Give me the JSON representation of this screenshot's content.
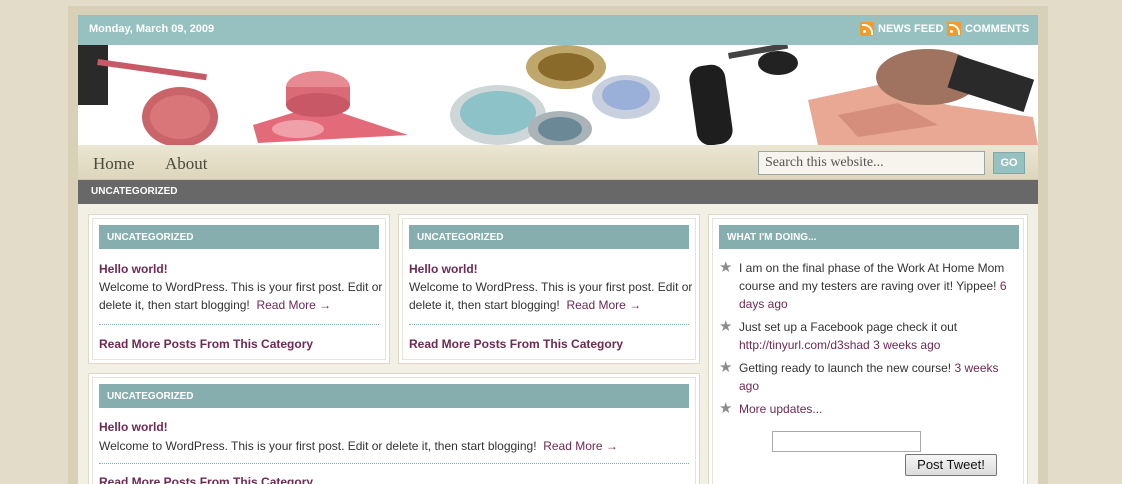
{
  "header": {
    "date": "Monday, March 09, 2009",
    "news_feed": "NEWS FEED",
    "comments": "COMMENTS"
  },
  "nav": {
    "items": [
      "Home",
      "About"
    ],
    "search_placeholder": "Search this website...",
    "go": "GO"
  },
  "category_bar": "UNCATEGORIZED",
  "posts": [
    {
      "category": "UNCATEGORIZED",
      "title": "Hello world!",
      "body": "Welcome to WordPress. This is your first post. Edit or delete it, then start blogging!",
      "read_more": "Read More →",
      "more_link": "Read More Posts From This Category"
    },
    {
      "category": "UNCATEGORIZED",
      "title": "Hello world!",
      "body": "Welcome to WordPress. This is your first post. Edit or delete it, then start blogging!",
      "read_more": "Read More →",
      "more_link": "Read More Posts From This Category"
    },
    {
      "category": "UNCATEGORIZED",
      "title": "Hello world!",
      "body": "Welcome to WordPress. This is your first post. Edit or delete it, then start blogging!",
      "read_more": "Read More →",
      "more_link": "Read More Posts From This Category"
    }
  ],
  "sidebar": {
    "title": "WHAT I'M DOING...",
    "tweets": [
      {
        "text": "I am on the final phase of the Work At Home Mom course and my testers are raving over it! Yippee!",
        "time": "6 days ago"
      },
      {
        "text": "Just set up a Facebook page check it out",
        "link": "http://tinyurl.com/d3shad",
        "time": "3 weeks ago"
      },
      {
        "text": "Getting ready to launch the new course!",
        "time": "3 weeks ago"
      }
    ],
    "more_updates": "More updates...",
    "tweet_button": "Post Tweet!"
  },
  "colors": {
    "accent_teal": "#96c1c0",
    "header_teal": "#86aeae",
    "link_plum": "#6e2a52",
    "category_bar": "#686868"
  }
}
